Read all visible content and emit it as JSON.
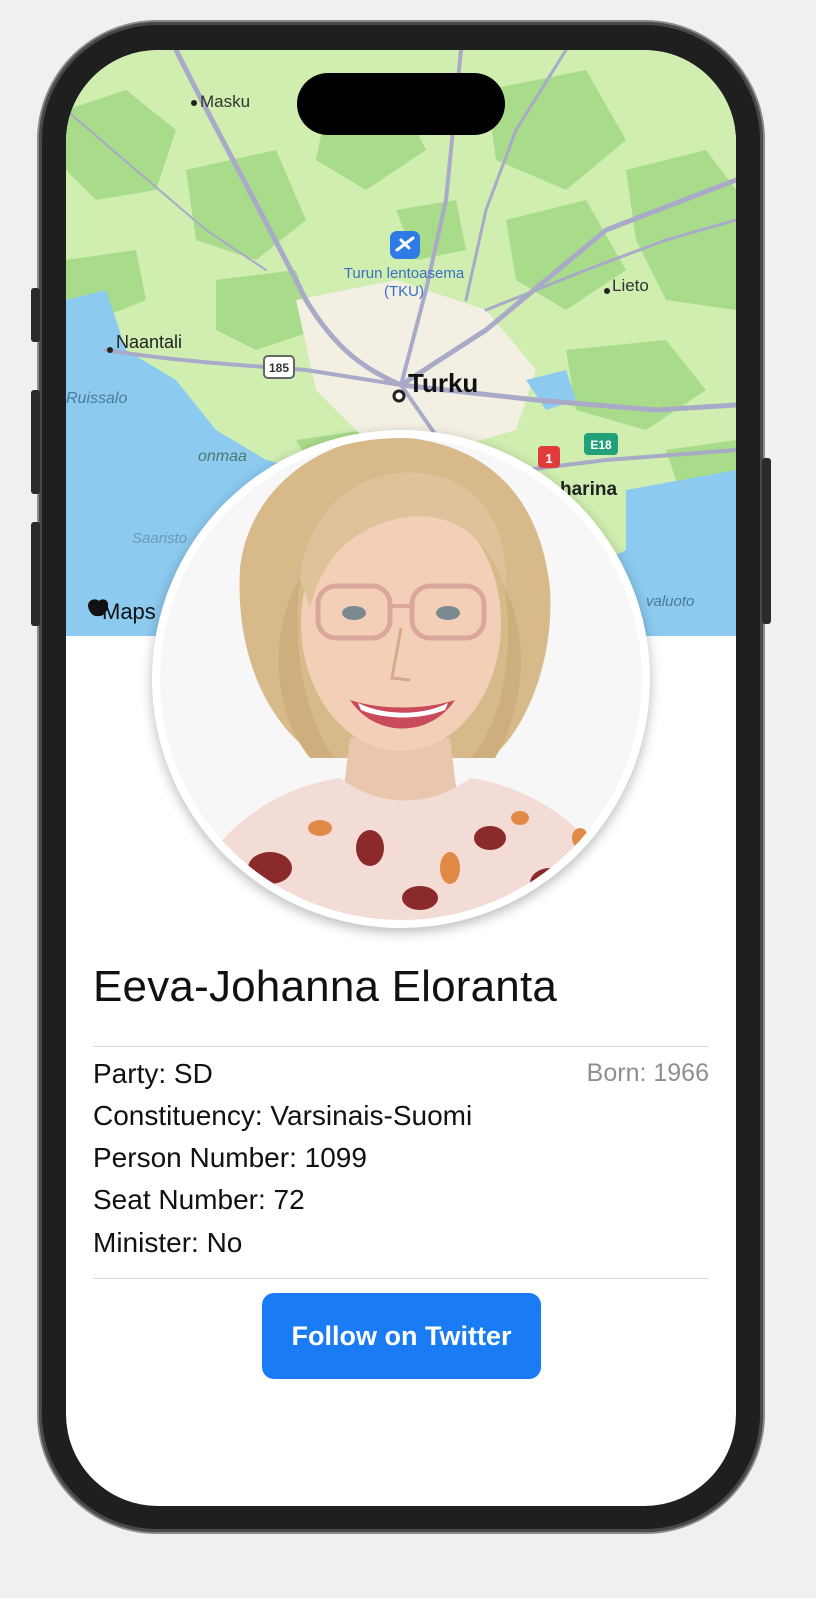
{
  "map": {
    "attribution": "Maps",
    "places": [
      {
        "name": "Masku"
      },
      {
        "name": "Turun lentoasema"
      },
      {
        "name": "(TKU)"
      },
      {
        "name": "Lieto"
      },
      {
        "name": "Naantali"
      },
      {
        "name": "Turku"
      },
      {
        "name": "Ruissalo"
      },
      {
        "name": "onmaa"
      },
      {
        "name": "Saaristo"
      },
      {
        "name": "harina"
      },
      {
        "name": "valuoto"
      }
    ],
    "road_shields": {
      "shield_185": "185",
      "shield_1": "1",
      "shield_e18": "E18"
    },
    "colors": {
      "land": "#cfeeb0",
      "forest": "#a8dc8a",
      "water": "#8ccaf0",
      "roads": "#a9a9c8",
      "urban": "#f3efe3"
    }
  },
  "profile": {
    "name": "Eeva-Johanna Eloranta",
    "born": "Born: 1966",
    "party": "Party: SD",
    "constituency": "Constituency: Varsinais-Suomi",
    "person_number": "Person Number: 1099",
    "seat_number": "Seat Number: 72",
    "minister": "Minister: No"
  },
  "actions": {
    "follow_label": "Follow on Twitter"
  },
  "colors": {
    "accent": "#1a7cf5"
  }
}
